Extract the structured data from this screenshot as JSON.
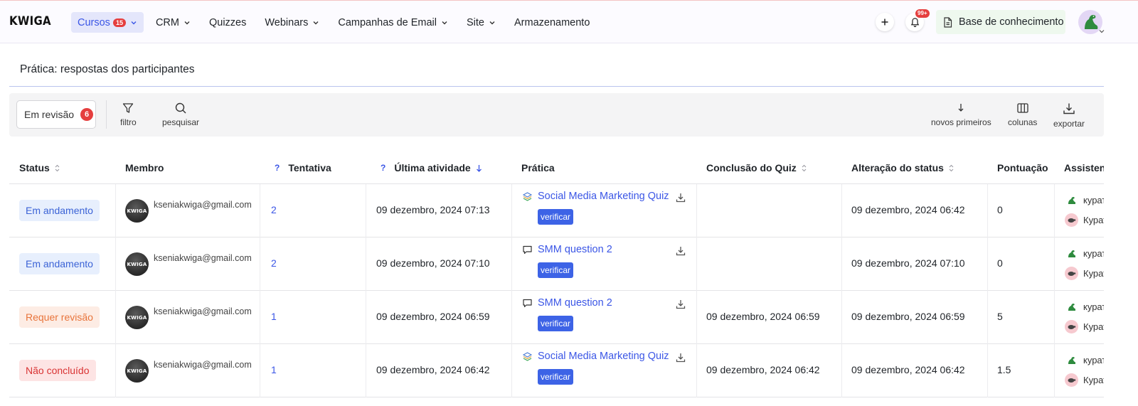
{
  "app": {
    "logo": "KWIGA"
  },
  "nav": {
    "items": [
      {
        "label": "Cursos",
        "badge": "15",
        "dropdown": true,
        "active": true
      },
      {
        "label": "CRM",
        "badge": "",
        "dropdown": true,
        "active": false
      },
      {
        "label": "Quizzes",
        "badge": "",
        "dropdown": false,
        "active": false
      },
      {
        "label": "Webinars",
        "badge": "",
        "dropdown": true,
        "active": false
      },
      {
        "label": "Campanhas de Email",
        "badge": "",
        "dropdown": true,
        "active": false
      },
      {
        "label": "Site",
        "badge": "",
        "dropdown": true,
        "active": false
      },
      {
        "label": "Armazenamento",
        "badge": "",
        "dropdown": false,
        "active": false
      }
    ],
    "notifications_badge": "99+",
    "knowledge_base": "Base de conhecimento"
  },
  "page": {
    "title": "Prática: respostas dos participantes"
  },
  "toolbar": {
    "status_filter": "Em revisão",
    "status_count": "6",
    "filter_label": "filtro",
    "search_label": "pesquisar",
    "sort_label": "novos primeiros",
    "columns_label": "colunas",
    "export_label": "exportar"
  },
  "table": {
    "headers": {
      "status": "Status",
      "member": "Membro",
      "attempt_help": "?",
      "attempt": "Tentativa",
      "last_help": "?",
      "last_activity": "Última atividade",
      "practice": "Prática",
      "quiz_completion": "Conclusão do Quiz",
      "status_change": "Alteração do status",
      "score": "Pontuação",
      "assistants": "Assistent"
    },
    "verify_label": "verificar",
    "rows": [
      {
        "status": "Em andamento",
        "status_kind": "prog",
        "email": "kseniakwiga@gmail.com",
        "avatar_text": "KWIGA",
        "attempt": "2",
        "last_activity": "09 dezembro, 2024 07:13",
        "practice": "Social Media Marketing Quiz",
        "practice_icon": "layers-icon",
        "quiz_completion": "",
        "status_change": "09 dezembro, 2024 06:42",
        "score": "0",
        "assistant_1": "курат",
        "assistant_2": "Курат"
      },
      {
        "status": "Em andamento",
        "status_kind": "prog",
        "email": "kseniakwiga@gmail.com",
        "avatar_text": "KWIGA",
        "attempt": "2",
        "last_activity": "09 dezembro, 2024 07:10",
        "practice": "SMM question 2",
        "practice_icon": "comment-icon",
        "quiz_completion": "",
        "status_change": "09 dezembro, 2024 07:10",
        "score": "0",
        "assistant_1": "курат",
        "assistant_2": "Курат"
      },
      {
        "status": "Requer revisão",
        "status_kind": "rev",
        "email": "kseniakwiga@gmail.com",
        "avatar_text": "KWIGA",
        "attempt": "1",
        "last_activity": "09 dezembro, 2024 06:59",
        "practice": "SMM question 2",
        "practice_icon": "comment-icon",
        "quiz_completion": "09 dezembro, 2024 06:59",
        "status_change": "09 dezembro, 2024 06:59",
        "score": "5",
        "assistant_1": "курат",
        "assistant_2": "Курат"
      },
      {
        "status": "Não concluído",
        "status_kind": "notc",
        "email": "kseniakwiga@gmail.com",
        "avatar_text": "KWIGA",
        "attempt": "1",
        "last_activity": "09 dezembro, 2024 06:42",
        "practice": "Social Media Marketing Quiz",
        "practice_icon": "layers-icon",
        "quiz_completion": "09 dezembro, 2024 06:42",
        "status_change": "09 dezembro, 2024 06:42",
        "score": "1.5",
        "assistant_1": "курат",
        "assistant_2": "Курат"
      }
    ]
  },
  "colors": {
    "accent": "#3b56e6",
    "badge_red": "#e53e3e",
    "in_progress_bg": "#e7effd",
    "review_bg": "#fdece4",
    "not_completed_bg": "#fde4e4"
  }
}
